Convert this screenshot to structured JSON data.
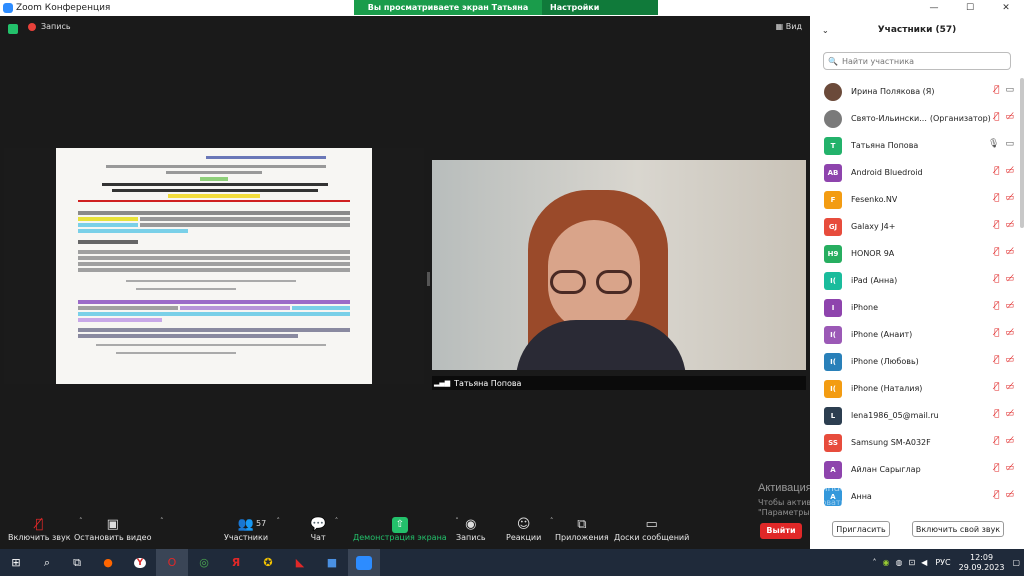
{
  "titlebar": {
    "title": "Zoom Конференция"
  },
  "banner": {
    "viewing": "Вы просматриваете экран Татьяна Попова",
    "view_settings": "Настройки просмотра"
  },
  "meeting": {
    "recording": "Запись",
    "view": "Вид"
  },
  "video": {
    "name": "Татьяна Попова"
  },
  "toolbar": {
    "mute": "Включить звук",
    "video": "Остановить видео",
    "participants": "Участники",
    "participants_count": "57",
    "chat": "Чат",
    "share": "Демонстрация экрана",
    "record": "Запись",
    "reactions": "Реакции",
    "apps": "Приложения",
    "whiteboards": "Доски сообщений",
    "leave": "Выйти"
  },
  "panel": {
    "title": "Участники (57)",
    "search_placeholder": "Найти участника",
    "participants": [
      {
        "initials": "",
        "name": "Ирина Полякова (Я)",
        "role": "",
        "color": "#6b4a3a",
        "muted": true,
        "video": true
      },
      {
        "initials": "",
        "name": "Свято-Ильински...",
        "role": "(Организатор)",
        "color": "#7a7a7a",
        "muted": true,
        "video": false
      },
      {
        "initials": "T",
        "name": "Татьяна Попова",
        "role": "",
        "color": "#23b26b",
        "muted": false,
        "video": true
      },
      {
        "initials": "AB",
        "name": "Android Bluedroid",
        "role": "",
        "color": "#8e44ad",
        "muted": true,
        "video": false
      },
      {
        "initials": "F",
        "name": "Fesenko.NV",
        "role": "",
        "color": "#f39c12",
        "muted": true,
        "video": false
      },
      {
        "initials": "GJ",
        "name": "Galaxy J4+",
        "role": "",
        "color": "#e74c3c",
        "muted": true,
        "video": false
      },
      {
        "initials": "H9",
        "name": "HONOR 9A",
        "role": "",
        "color": "#27ae60",
        "muted": true,
        "video": false
      },
      {
        "initials": "I(",
        "name": "iPad (Анна)",
        "role": "",
        "color": "#1abc9c",
        "muted": true,
        "video": false
      },
      {
        "initials": "I",
        "name": "iPhone",
        "role": "",
        "color": "#8e44ad",
        "muted": true,
        "video": false
      },
      {
        "initials": "I(",
        "name": "iPhone (Анаит)",
        "role": "",
        "color": "#9b59b6",
        "muted": true,
        "video": false
      },
      {
        "initials": "I(",
        "name": "iPhone (Любовь)",
        "role": "",
        "color": "#2980b9",
        "muted": true,
        "video": false
      },
      {
        "initials": "I(",
        "name": "iPhone (Наталия)",
        "role": "",
        "color": "#f39c12",
        "muted": true,
        "video": false
      },
      {
        "initials": "L",
        "name": "lena1986_05@mail.ru",
        "role": "",
        "color": "#2c3e50",
        "muted": true,
        "video": false
      },
      {
        "initials": "SS",
        "name": "Samsung SM-A032F",
        "role": "",
        "color": "#e74c3c",
        "muted": true,
        "video": false
      },
      {
        "initials": "A",
        "name": "Айлан Сарыглар",
        "role": "",
        "color": "#8e44ad",
        "muted": true,
        "video": false
      },
      {
        "initials": "A",
        "name": "Анна",
        "role": "",
        "color": "#3498db",
        "muted": true,
        "video": false
      }
    ],
    "invite": "Пригласить",
    "unmute_me": "Включить свой звук"
  },
  "watermark": {
    "line1": "Активация Windows",
    "line2": "Чтобы активировать Windows, перейдите в раздел \"Параметры\"."
  },
  "taskbar": {
    "time": "12:09",
    "date": "29.09.2023",
    "lang": "РУС"
  }
}
